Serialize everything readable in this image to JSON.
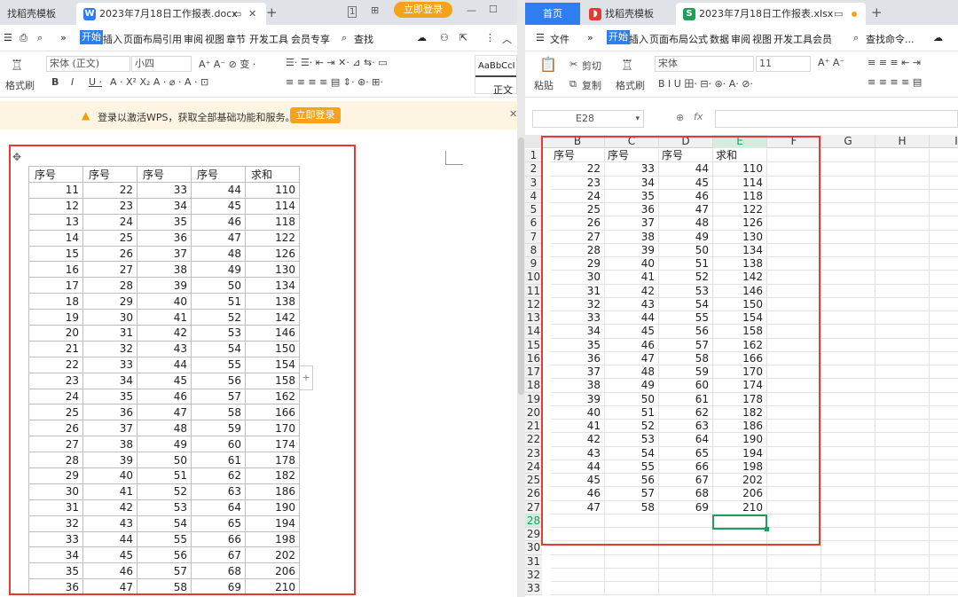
{
  "left": {
    "tabs": {
      "tab1": "找稻壳模板",
      "tab2": "2023年7月18日工作报表.docx",
      "login": "立即登录"
    },
    "menu": {
      "start": "开始",
      "items": [
        "插入",
        "页面布局",
        "引用",
        "审阅",
        "视图",
        "章节",
        "开发工具",
        "会员专享"
      ],
      "search": "查找"
    },
    "ribbon": {
      "format_brush": "格式刷",
      "font": "宋体 (正文)",
      "size": "小四",
      "style_preview": "AaBbCcI",
      "style_name": "正文"
    },
    "notice": {
      "text": "登录以激活WPS，获取全部基础功能和服务。",
      "button": "立即登录"
    },
    "table": {
      "headers": [
        "序号",
        "序号",
        "序号",
        "序号",
        "求和"
      ],
      "rows": [
        [
          11,
          22,
          33,
          44,
          110
        ],
        [
          12,
          23,
          34,
          45,
          114
        ],
        [
          13,
          24,
          35,
          46,
          118
        ],
        [
          14,
          25,
          36,
          47,
          122
        ],
        [
          15,
          26,
          37,
          48,
          126
        ],
        [
          16,
          27,
          38,
          49,
          130
        ],
        [
          17,
          28,
          39,
          50,
          134
        ],
        [
          18,
          29,
          40,
          51,
          138
        ],
        [
          19,
          30,
          41,
          52,
          142
        ],
        [
          20,
          31,
          42,
          53,
          146
        ],
        [
          21,
          32,
          43,
          54,
          150
        ],
        [
          22,
          33,
          44,
          55,
          154
        ],
        [
          23,
          34,
          45,
          56,
          158
        ],
        [
          24,
          35,
          46,
          57,
          162
        ],
        [
          25,
          36,
          47,
          58,
          166
        ],
        [
          26,
          37,
          48,
          59,
          170
        ],
        [
          27,
          38,
          49,
          60,
          174
        ],
        [
          28,
          39,
          50,
          61,
          178
        ],
        [
          29,
          40,
          51,
          62,
          182
        ],
        [
          30,
          41,
          52,
          63,
          186
        ],
        [
          31,
          42,
          53,
          64,
          190
        ],
        [
          32,
          43,
          54,
          65,
          194
        ],
        [
          33,
          44,
          55,
          66,
          198
        ],
        [
          34,
          45,
          56,
          67,
          202
        ],
        [
          35,
          46,
          57,
          68,
          206
        ],
        [
          36,
          47,
          58,
          69,
          210
        ]
      ]
    }
  },
  "right": {
    "tabs": {
      "home": "首页",
      "tab1": "找稻壳模板",
      "tab2": "2023年7月18日工作报表.xlsx"
    },
    "menu": {
      "file": "文件",
      "start": "开始",
      "items": [
        "插入",
        "页面布局",
        "公式",
        "数据",
        "审阅",
        "视图",
        "开发工具",
        "会员"
      ],
      "search": "查找命令..."
    },
    "ribbon": {
      "paste": "粘贴",
      "cut": "剪切",
      "copy": "复制",
      "format_brush": "格式刷",
      "font": "宋体",
      "size": "11"
    },
    "name_box": "E28",
    "fx": "fx",
    "columns": [
      "B",
      "C",
      "D",
      "E",
      "F",
      "G",
      "H",
      "I"
    ],
    "row_numbers": [
      1,
      2,
      3,
      4,
      5,
      6,
      7,
      8,
      9,
      10,
      11,
      12,
      13,
      14,
      15,
      16,
      17,
      18,
      19,
      20,
      21,
      22,
      23,
      24,
      25,
      26,
      27,
      28,
      29,
      30,
      31,
      32,
      33
    ],
    "sheet_headers": [
      "序号",
      "序号",
      "序号",
      "求和"
    ],
    "sheet_rows": [
      [
        22,
        33,
        44,
        110
      ],
      [
        23,
        34,
        45,
        114
      ],
      [
        24,
        35,
        46,
        118
      ],
      [
        25,
        36,
        47,
        122
      ],
      [
        26,
        37,
        48,
        126
      ],
      [
        27,
        38,
        49,
        130
      ],
      [
        28,
        39,
        50,
        134
      ],
      [
        29,
        40,
        51,
        138
      ],
      [
        30,
        41,
        52,
        142
      ],
      [
        31,
        42,
        53,
        146
      ],
      [
        32,
        43,
        54,
        150
      ],
      [
        33,
        44,
        55,
        154
      ],
      [
        34,
        45,
        56,
        158
      ],
      [
        35,
        46,
        57,
        162
      ],
      [
        36,
        47,
        58,
        166
      ],
      [
        37,
        48,
        59,
        170
      ],
      [
        38,
        49,
        60,
        174
      ],
      [
        39,
        50,
        61,
        178
      ],
      [
        40,
        51,
        62,
        182
      ],
      [
        41,
        52,
        63,
        186
      ],
      [
        42,
        53,
        64,
        190
      ],
      [
        43,
        54,
        65,
        194
      ],
      [
        44,
        55,
        66,
        198
      ],
      [
        45,
        56,
        67,
        202
      ],
      [
        46,
        57,
        68,
        206
      ],
      [
        47,
        58,
        69,
        210
      ]
    ]
  },
  "colors": {
    "accent_blue": "#2f7ef0",
    "annotation_red": "#e53935",
    "login_orange": "#f7a21b",
    "excel_green": "#1e9e5a",
    "selection_green": "#1e9e5a"
  }
}
